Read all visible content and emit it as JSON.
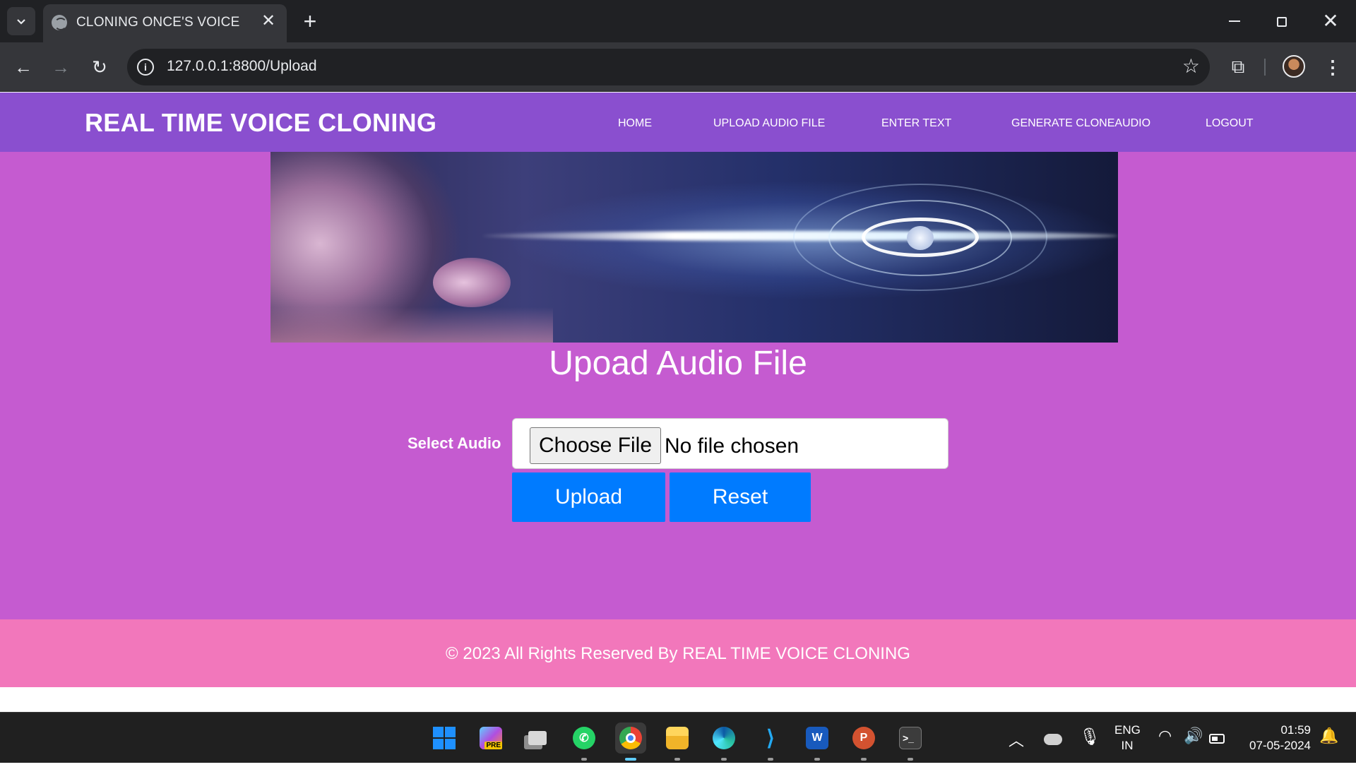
{
  "browser": {
    "tab_title": "CLONING ONCE'S VOICE",
    "url": "127.0.0.1:8800/Upload",
    "new_tab_symbol": "+",
    "icons": [
      "tab-search-icon",
      "globe-icon",
      "close-icon",
      "back-icon",
      "forward-icon",
      "reload-icon",
      "info-icon",
      "star-icon",
      "extensions-icon",
      "kebab-menu-icon"
    ]
  },
  "site": {
    "brand": "REAL TIME VOICE CLONING",
    "nav": {
      "home": "HOME",
      "upload": "UPLOAD AUDIO FILE",
      "text": "ENTER TEXT",
      "generate": "GENERATE CLONEAUDIO",
      "logout": "LOGOUT"
    },
    "colors": {
      "navbar": "#8a4fcf",
      "background": "#c55bd0",
      "footer": "#f277bb",
      "button": "#007bff"
    }
  },
  "form": {
    "heading": "Upoad Audio File",
    "label": "Select Audio",
    "choose_file": "Choose File",
    "file_status": "No file chosen",
    "upload": "Upload",
    "reset": "Reset"
  },
  "footer": {
    "text": "© 2023 All Rights Reserved By REAL TIME VOICE CLONING"
  },
  "taskbar": {
    "apps": [
      "windows-start",
      "copilot-pre",
      "task-view",
      "whatsapp",
      "chrome",
      "file-explorer",
      "edge",
      "vscode",
      "word",
      "powerpoint",
      "terminal"
    ],
    "pre_badge": "PRE",
    "lang_top": "ENG",
    "lang_bottom": "IN",
    "time": "01:59",
    "date": "07-05-2024"
  }
}
